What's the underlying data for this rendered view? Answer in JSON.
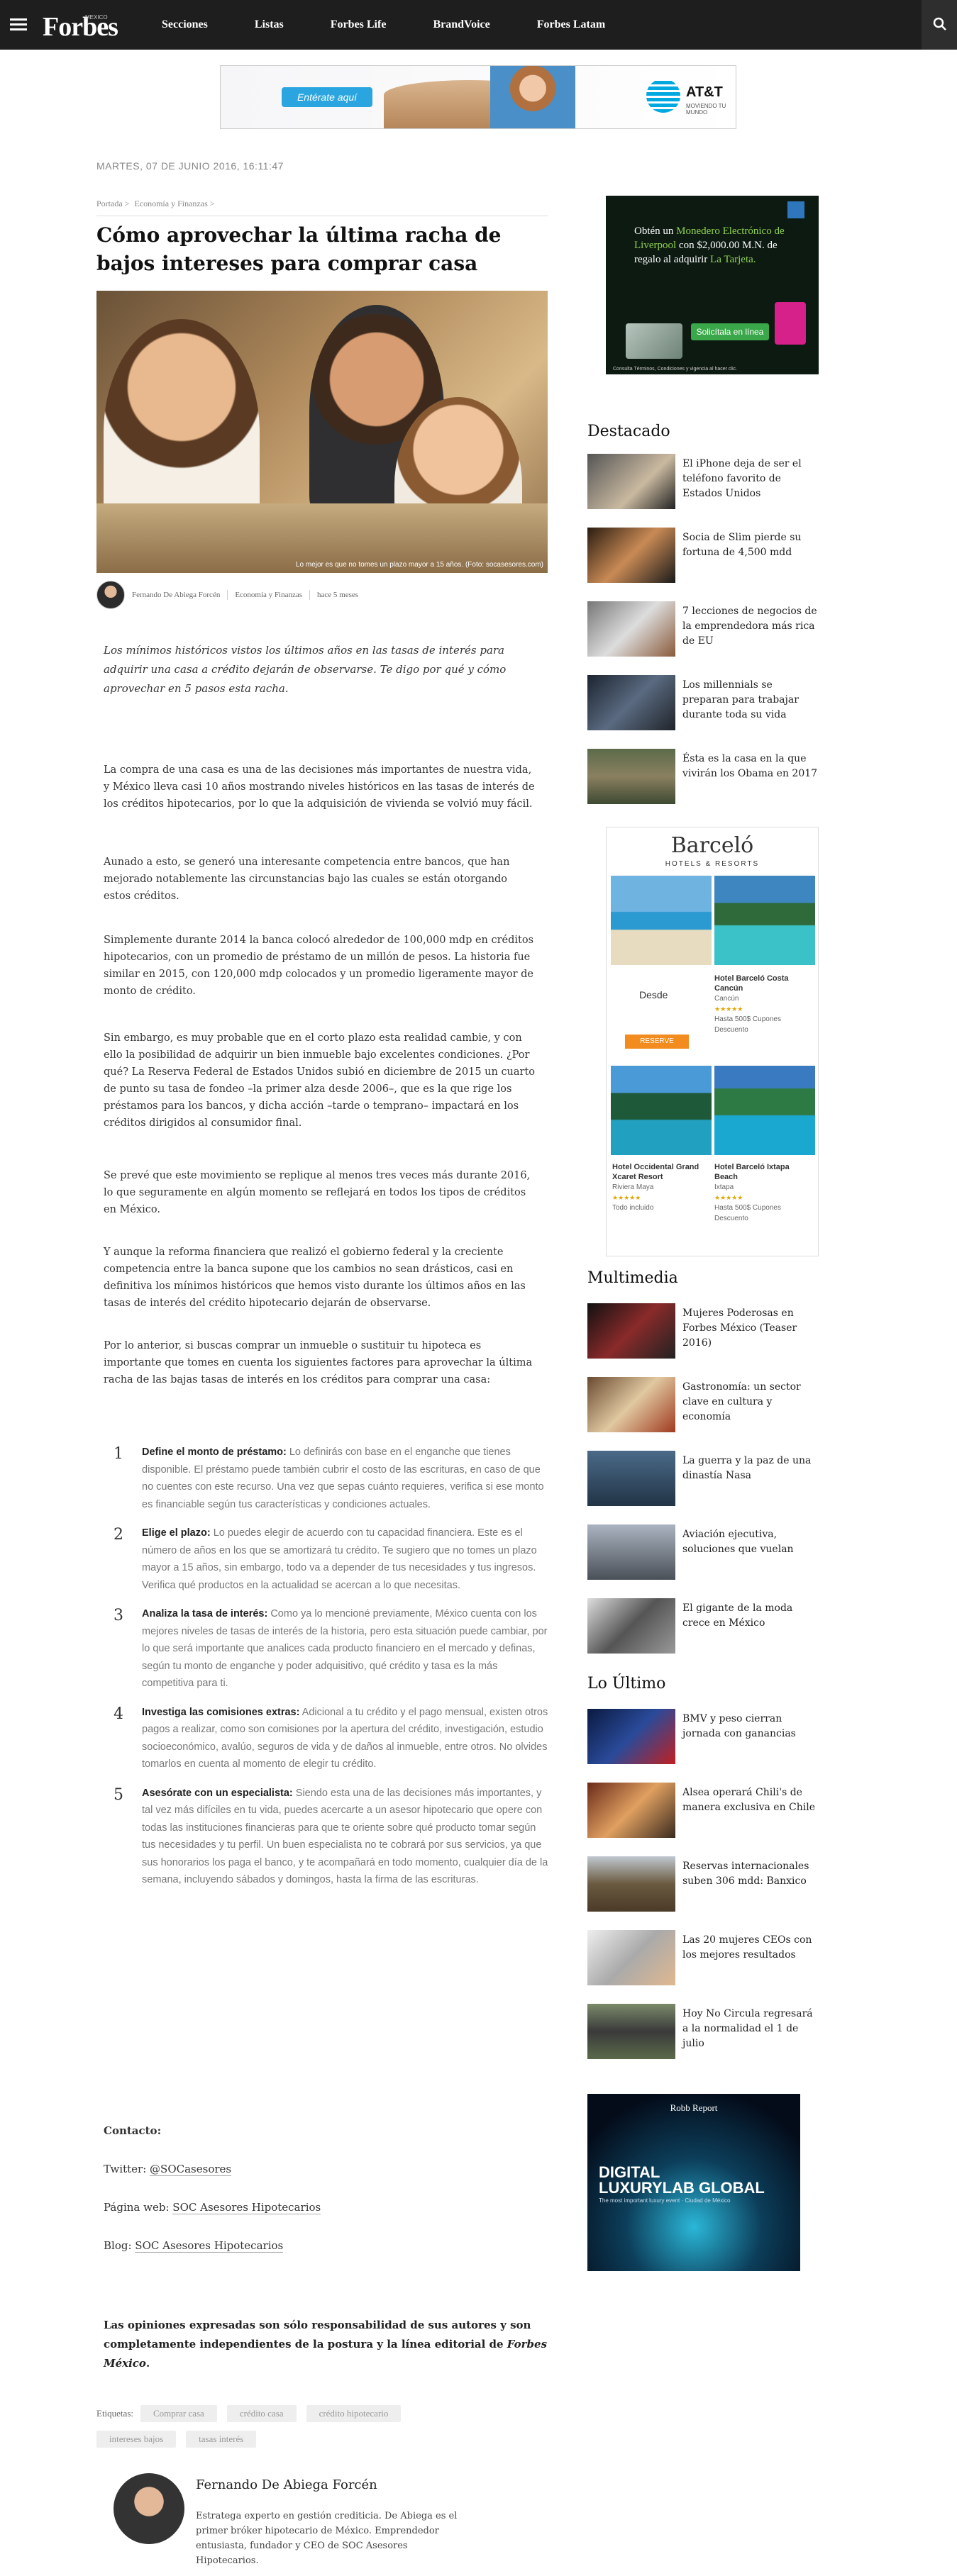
{
  "nav": {
    "logo": "Forbes",
    "logo_sup": "MEXICO",
    "links": [
      "Secciones",
      "Listas",
      "Forbes Life",
      "BrandVoice",
      "Forbes Latam"
    ]
  },
  "top_ad": {
    "button": "Entérate aquí",
    "brand": "AT&T",
    "tagline": "MOVIENDO TU MUNDO"
  },
  "article": {
    "date": "MARTES, 07 DE JUNIO 2016, 16:11:47",
    "breadcrumb": [
      "Portada >",
      "Economía y Finanzas >"
    ],
    "title": "Cómo aprovechar la última racha de bajos intereses para comprar casa",
    "hero_caption": "Lo mejor es que no tomes un plazo mayor a 15 años. (Foto: socasesores.com)",
    "author": "Fernando De Abiega Forcén",
    "section": "Economía y Finanzas",
    "time_ago": "hace 5 meses",
    "lede": "Los mínimos históricos vistos los últimos años en las tasas de interés para adquirir una casa a crédito dejarán de observarse. Te digo por qué y cómo aprovechar en 5 pasos esta racha.",
    "paragraphs": [
      "La compra de una casa es una de las decisiones más importantes de nuestra vida, y México lleva casi 10 años mostrando niveles históricos en las tasas de interés de los créditos hipotecarios, por lo que la adquisición de vivienda se volvió muy fácil.",
      "Aunado a esto, se generó una interesante competencia entre bancos, que han mejorado notablemente las circunstancias bajo las cuales se están otorgando estos créditos.",
      "Simplemente durante 2014 la banca colocó alrededor de 100,000 mdp en créditos hipotecarios, con un promedio de préstamo de un millón de pesos. La historia fue similar en 2015, con 120,000 mdp colocados y un promedio ligeramente mayor de monto de crédito.",
      "Sin embargo, es muy probable que en el corto plazo esta realidad cambie, y con ello la posibilidad de adquirir un bien inmueble bajo excelentes condiciones. ¿Por qué? La Reserva Federal de Estados Unidos subió en diciembre de 2015 un cuarto de punto su tasa de fondeo –la primer alza desde 2006–, que es la que rige los préstamos para los bancos, y dicha acción –tarde o temprano– impactará en los créditos dirigidos al consumidor final.",
      "Se prevé que este movimiento se replique al menos tres veces más durante 2016, lo que seguramente en algún momento se reflejará en todos los tipos de créditos en México.",
      "Y aunque la reforma financiera que realizó el gobierno federal y la creciente competencia entre la banca supone que los cambios no sean drásticos, casi en definitiva los mínimos históricos que hemos visto durante los últimos años en las tasas de interés del crédito hipotecario dejarán de observarse.",
      "Por lo anterior, si buscas comprar un inmueble o sustituir tu hipoteca es importante que tomes en cuenta los siguientes factores para aprovechar la última racha de las bajas tasas de interés en los créditos para comprar una casa:"
    ],
    "steps": [
      {
        "num": "1",
        "head": "Define el monto de préstamo:",
        "text": " Lo definirás con base en el enganche que tienes disponible. El préstamo puede también cubrir el costo de las escrituras, en caso de que no cuentes con este recurso. Una vez que sepas cuánto requieres, verifica si ese monto es financiable según tus características y condiciones actuales."
      },
      {
        "num": "2",
        "head": "Elige el plazo:",
        "text": " Lo puedes elegir de acuerdo con tu capacidad financiera. Este es el número de años en los que se amortizará tu crédito. Te sugiero que no tomes un plazo mayor a 15 años, sin embargo, todo va a depender de tus necesidades y tus ingresos. Verifica qué productos en la actualidad se acercan a lo que necesitas."
      },
      {
        "num": "3",
        "head": "Analiza la tasa de interés:",
        "text": " Como ya lo mencioné previamente, México cuenta con los mejores niveles de tasas de interés de la historia, pero esta situación puede cambiar, por lo que será importante que analices cada producto financiero en el mercado y definas, según tu monto de enganche y poder adquisitivo, qué crédito y tasa es la más competitiva para ti."
      },
      {
        "num": "4",
        "head": "Investiga las comisiones extras:",
        "text": " Adicional a tu crédito y el pago mensual, existen otros pagos a realizar, como son comisiones por la apertura del crédito, investigación, estudio socioeconómico, avalúo, seguros de vida y de daños al inmueble, entre otros. No olvides tomarlos en cuenta al momento de elegir tu crédito."
      },
      {
        "num": "5",
        "head": "Asesórate con un especialista:",
        "text": " Siendo esta una de las decisiones más importantes, y tal vez más difíciles en tu vida, puedes acercarte a un asesor hipotecario que opere con todas las instituciones financieras para que te oriente sobre qué producto tomar según tus necesidades y tu perfil. Un buen especialista no te cobrará por sus servicios, ya que sus honorarios los paga el banco, y te acompañará en todo momento, cualquier día de la semana, incluyendo sábados y domingos, hasta la firma de las escrituras."
      }
    ],
    "contact_label": "Contacto:",
    "twitter_label": "Twitter:",
    "twitter": "@SOCasesores",
    "web_label": "Página web:",
    "web": "SOC Asesores Hipotecarios",
    "blog_label": "Blog:",
    "blog": "SOC Asesores Hipotecarios",
    "disclaimer_a": "Las opiniones expresadas son sólo responsabilidad de sus autores y son completamente independientes de la postura y la línea editorial de ",
    "disclaimer_b": "Forbes México",
    "disclaimer_c": ".",
    "tags_label": "Etiquetas:",
    "tags_row1": [
      "Comprar casa",
      "crédito casa",
      "crédito hipotecario"
    ],
    "tags_row2": [
      "intereses bajos",
      "tasas interés"
    ],
    "author_bio": "Estratega experto en gestión crediticia. De Abiega es el primer bróker hipotecario de México. Emprendedor entusiasta, fundador y CEO de SOC Asesores Hipotecarios."
  },
  "sidebar": {
    "ad1": {
      "line1": "Obtén un ",
      "highlight1": "Monedero Electrónico de Liverpool",
      "line2": " con $2,000.00 ",
      "line2b": "M.N. de regalo al adquirir ",
      "highlight2": "La Tarjeta.",
      "cta": "Solicítala en línea",
      "fine": "Consulta Términos, Condiciones y vigencia al hacer clic."
    },
    "destacado_title": "Destacado",
    "destacado": [
      "El iPhone deja de ser el teléfono favorito de Estados Unidos",
      "Socia de Slim pierde su fortuna de 4,500 mdd",
      "7 lecciones de negocios de la emprendedora más rica de EU",
      "Los millennials se preparan para trabajar durante toda su vida",
      "Ésta es la casa en la que vivirán los Obama en 2017"
    ],
    "ad2": {
      "logo": "Barceló",
      "sub": "HOTELS & RESORTS",
      "desde": "Desde",
      "reserve": "RESERVE",
      "h1_name": "Hotel Barceló Costa Cancún",
      "h1_city": "Cancún",
      "h1_price": "Hasta 500$ Cupones Descuento",
      "h2_name": "Hotel Occidental Grand Xcaret Resort",
      "h2_city": "Riviera Maya",
      "h2_price": "Todo incluido",
      "h3_name": "Hotel Barceló Ixtapa Beach",
      "h3_city": "Ixtapa",
      "h3_price": "Hasta 500$ Cupones Descuento",
      "stars": "★★★★★"
    },
    "multimedia_title": "Multimedia",
    "multimedia": [
      "Mujeres Poderosas en Forbes México (Teaser 2016)",
      "Gastronomía: un sector clave en cultura y economía",
      "La guerra y la paz de una dinastía Nasa",
      "Aviación ejecutiva, soluciones que vuelan",
      "El gigante de la moda crece en México"
    ],
    "ultimo_title": "Lo Último",
    "ultimo": [
      "BMV y peso cierran jornada con ganancias",
      "Alsea operará Chili's de manera exclusiva en Chile",
      "Reservas internacionales suben 306 mdd: Banxico",
      "Las 20 mujeres CEOs con los mejores resultados",
      "Hoy No Circula regresará a la normalidad el 1 de julio"
    ],
    "ad3": {
      "brand": "Robb Report",
      "head1": "DIGITAL",
      "head2": "LUXURYLAB GLOBAL",
      "sub": "The most important luxury event · Ciudad de México"
    }
  },
  "colors": {
    "nav_bg": "#1e1e1e",
    "accent_blue": "#2aa5df",
    "text": "#333333"
  }
}
